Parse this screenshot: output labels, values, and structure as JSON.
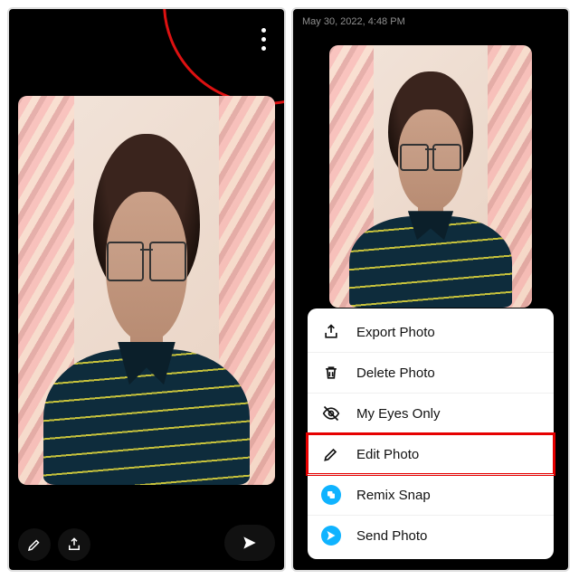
{
  "timestamp": "May 30, 2022, 4:48 PM",
  "menu": {
    "export": "Export Photo",
    "delete": "Delete Photo",
    "eyesonly": "My Eyes Only",
    "edit": "Edit Photo",
    "remix": "Remix Snap",
    "send": "Send Photo"
  }
}
